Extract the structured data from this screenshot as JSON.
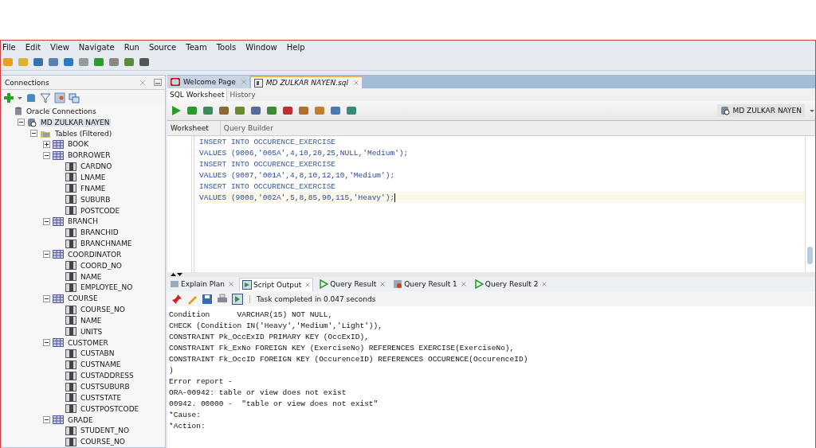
{
  "menu": [
    "File",
    "Edit",
    "View",
    "Navigate",
    "Run",
    "Source",
    "Team",
    "Tools",
    "Window",
    "Help"
  ],
  "connections_panel": {
    "title": "Connections",
    "tree": [
      {
        "label": "Oracle Connections",
        "kind": "root",
        "children": [
          {
            "label": "MD ZULKAR NAYEN",
            "kind": "connection",
            "expanded": true,
            "selected": true,
            "children": [
              {
                "label": "Tables (Filtered)",
                "kind": "folder",
                "expanded": true,
                "children": [
                  {
                    "label": "BOOK",
                    "kind": "table",
                    "expanded": false
                  },
                  {
                    "label": "BORROWER",
                    "kind": "table",
                    "expanded": true,
                    "children": [
                      {
                        "label": "CARDNO",
                        "kind": "column"
                      },
                      {
                        "label": "LNAME",
                        "kind": "column"
                      },
                      {
                        "label": "FNAME",
                        "kind": "column"
                      },
                      {
                        "label": "SUBURB",
                        "kind": "column"
                      },
                      {
                        "label": "POSTCODE",
                        "kind": "column"
                      }
                    ]
                  },
                  {
                    "label": "BRANCH",
                    "kind": "table",
                    "expanded": true,
                    "children": [
                      {
                        "label": "BRANCHID",
                        "kind": "column"
                      },
                      {
                        "label": "BRANCHNAME",
                        "kind": "column"
                      }
                    ]
                  },
                  {
                    "label": "COORDINATOR",
                    "kind": "table",
                    "expanded": true,
                    "children": [
                      {
                        "label": "COORD_NO",
                        "kind": "column"
                      },
                      {
                        "label": "NAME",
                        "kind": "column"
                      },
                      {
                        "label": "EMPLOYEE_NO",
                        "kind": "column"
                      }
                    ]
                  },
                  {
                    "label": "COURSE",
                    "kind": "table",
                    "expanded": true,
                    "children": [
                      {
                        "label": "COURSE_NO",
                        "kind": "column"
                      },
                      {
                        "label": "NAME",
                        "kind": "column"
                      },
                      {
                        "label": "UNITS",
                        "kind": "column"
                      }
                    ]
                  },
                  {
                    "label": "CUSTOMER",
                    "kind": "table",
                    "expanded": true,
                    "children": [
                      {
                        "label": "CUSTABN",
                        "kind": "column"
                      },
                      {
                        "label": "CUSTNAME",
                        "kind": "column"
                      },
                      {
                        "label": "CUSTADDRESS",
                        "kind": "column"
                      },
                      {
                        "label": "CUSTSUBURB",
                        "kind": "column"
                      },
                      {
                        "label": "CUSTSTATE",
                        "kind": "column"
                      },
                      {
                        "label": "CUSTPOSTCODE",
                        "kind": "column"
                      }
                    ]
                  },
                  {
                    "label": "GRADE",
                    "kind": "table",
                    "expanded": true,
                    "children": [
                      {
                        "label": "STUDENT_NO",
                        "kind": "column"
                      },
                      {
                        "label": "COURSE_NO",
                        "kind": "column"
                      }
                    ]
                  }
                ]
              }
            ]
          }
        ]
      }
    ]
  },
  "editor_tabs": [
    {
      "label": "Welcome Page",
      "selected": false
    },
    {
      "label": "MD ZULKAR NAYEN.sql",
      "selected": true
    }
  ],
  "worksheet_tabs": [
    {
      "label": "SQL Worksheet",
      "selected": true
    },
    {
      "label": "History",
      "selected": false
    }
  ],
  "connection_selector": "MD ZULKAR NAYEN",
  "view_tabs": [
    {
      "label": "Worksheet",
      "selected": true
    },
    {
      "label": "Query Builder",
      "selected": false
    }
  ],
  "code_lines": [
    {
      "text": "INSERT INTO OCCURENCE_EXERCISE",
      "current": false
    },
    {
      "text": "VALUES (9006,'005A',4,10,20,25,NULL,'Medium');",
      "current": false
    },
    {
      "text": "INSERT INTO OCCURENCE_EXERCISE",
      "current": false
    },
    {
      "text": "VALUES (9007,'001A',4,8,10,12,10,'Medium');",
      "current": false
    },
    {
      "text": "INSERT INTO OCCURENCE_EXERCISE",
      "current": false
    },
    {
      "text": "VALUES (9008,'002A',5,8,85,90,115,'Heavy');",
      "current": true
    }
  ],
  "result_tabs": [
    {
      "label": "Explain Plan",
      "selected": false
    },
    {
      "label": "Script Output",
      "selected": true
    },
    {
      "label": "Query Result",
      "selected": false
    },
    {
      "label": "Query Result 1",
      "selected": false
    },
    {
      "label": "Query Result 2",
      "selected": false
    }
  ],
  "task_status": "Task completed in 0.047 seconds",
  "output_lines": [
    "Condition      VARCHAR(15) NOT NULL,",
    "CHECK (Condition IN('Heavy','Medium','Light')),",
    "CONSTRAINT Pk_OccExID PRIMARY KEY (OccExID),",
    "CONSTRAINT Fk_ExNo FOREIGN KEY (ExerciseNo) REFERENCES EXERCISE(ExerciseNo),",
    "CONSTRAINT Fk_OccID FOREIGN KEY (OccurenceID) REFERENCES OCCURENCE(OccurenceID)",
    ")",
    "Error report -",
    "ORA-00942: table or view does not exist",
    "00942. 00000 -  \"table or view does not exist\"",
    "*Cause:",
    "*Action:"
  ]
}
